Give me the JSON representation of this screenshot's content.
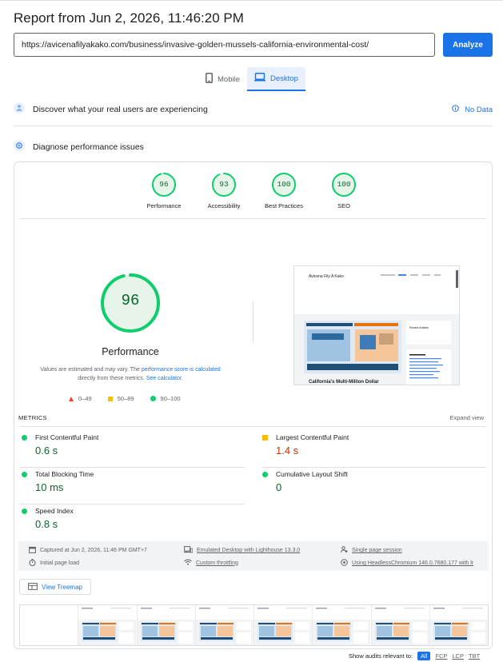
{
  "report": {
    "title": "Report from Jun 2, 2026, 11:46:20 PM"
  },
  "url_input": {
    "value": "https://avicenafilyakako.com/business/invasive-golden-mussels-california-environmental-cost/"
  },
  "analyze_button": {
    "label": "Analyze"
  },
  "device_tabs": [
    {
      "label": "Mobile",
      "active": false
    },
    {
      "label": "Desktop",
      "active": true
    }
  ],
  "field_data": {
    "heading": "Discover what your real users are experiencing",
    "status": "No Data"
  },
  "lab": {
    "heading": "Diagnose performance issues"
  },
  "categories": [
    {
      "name": "Performance",
      "score": "96"
    },
    {
      "name": "Accessibility",
      "score": "93"
    },
    {
      "name": "Best Practices",
      "score": "100"
    },
    {
      "name": "SEO",
      "score": "100"
    }
  ],
  "performance": {
    "score": "96",
    "score_fraction": 0.96,
    "title": "Performance",
    "note_pre": "Values are estimated and may vary. The",
    "note_link": "performance score is calculated",
    "note_mid": "directly from these metrics.",
    "note_link2": "See calculator."
  },
  "legend": {
    "fail": "0–49",
    "average": "50–89",
    "pass": "90–100"
  },
  "colors": {
    "pass": "#0cce6b",
    "average": "#fbbc04",
    "fail": "#eb4335",
    "accent": "#1a73e8"
  },
  "metrics": {
    "heading": "METRICS",
    "expand": "Expand view",
    "items": [
      {
        "name": "First Contentful Paint",
        "value": "0.6 s",
        "rating": "pass"
      },
      {
        "name": "Largest Contentful Paint",
        "value": "1.4 s",
        "rating": "average"
      },
      {
        "name": "Total Blocking Time",
        "value": "10 ms",
        "rating": "pass"
      },
      {
        "name": "Cumulative Layout Shift",
        "value": "0",
        "rating": "pass"
      },
      {
        "name": "Speed Index",
        "value": "0.8 s",
        "rating": "pass"
      }
    ]
  },
  "runtime": {
    "captured": "Captured at Jun 2, 2026, 11:46 PM GMT+7",
    "load": "Initial page load",
    "emulation": "Emulated Desktop with Lighthouse 13.3.0",
    "throttling": "Custom throttling",
    "session": "Single page session",
    "browser": "Using HeadlessChromium 146.0.7680.177 with lr"
  },
  "treemap": {
    "label": "View Treemap"
  },
  "screenshot": {
    "site_name": "Avicena Fily A Kako",
    "headline": "California's Multi-Million Dollar",
    "sidebar_title": "Recent Articles"
  },
  "footer": {
    "label": "Show audits relevant to:",
    "filters": [
      "All",
      "FCP",
      "LCP",
      "TBT"
    ]
  }
}
